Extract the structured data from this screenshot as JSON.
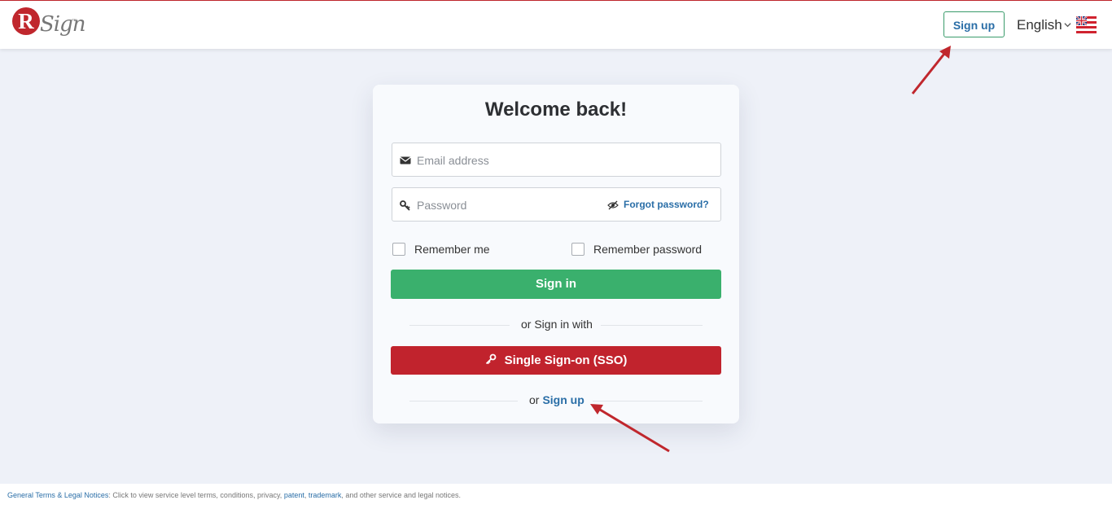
{
  "header": {
    "logo_letter": "R",
    "logo_word": "Sign",
    "logo_tm": "™",
    "signup_label": "Sign up",
    "language_label": "English",
    "language_icon": "chevron-down-icon",
    "flag_icon": "uk-flag-icon"
  },
  "login": {
    "title": "Welcome back!",
    "email_placeholder": "Email address",
    "email_value": "",
    "password_placeholder": "Password",
    "password_value": "",
    "forgot_label": "Forgot password?",
    "remember_me_label": "Remember me",
    "remember_password_label": "Remember password",
    "signin_label": "Sign in",
    "divider_label": "or Sign in with",
    "sso_label": "Single Sign-on (SSO)",
    "or_label": "or",
    "signup_link_label": "Sign up"
  },
  "footer": {
    "terms_link": "General Terms & Legal Notices",
    "text_1": ": Click to view service level terms, conditions, privacy,",
    "patent_link": "patent",
    "comma": ",",
    "trademark_link": "trademark",
    "text_2": ", and other service and legal notices."
  },
  "colors": {
    "brand_red": "#c1232d",
    "signin_green": "#3ab06d",
    "link_blue": "#2a6ea7",
    "page_bg": "#eef1f8"
  }
}
